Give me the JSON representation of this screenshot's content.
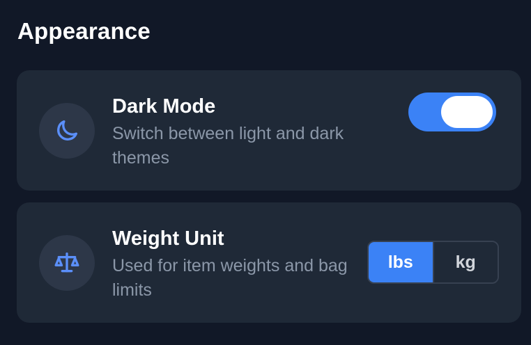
{
  "section": {
    "title": "Appearance"
  },
  "dark_mode": {
    "icon": "moon-icon",
    "title": "Dark Mode",
    "description": "Switch between light and dark themes",
    "enabled": true
  },
  "weight_unit": {
    "icon": "scale-icon",
    "title": "Weight Unit",
    "description": "Used for item weights and bag limits",
    "options": [
      "lbs",
      "kg"
    ],
    "selected": "lbs"
  },
  "colors": {
    "background": "#111827",
    "card": "#1f2937",
    "accent": "#3b82f6",
    "text_primary": "#ffffff",
    "text_secondary": "#8b97a8"
  }
}
